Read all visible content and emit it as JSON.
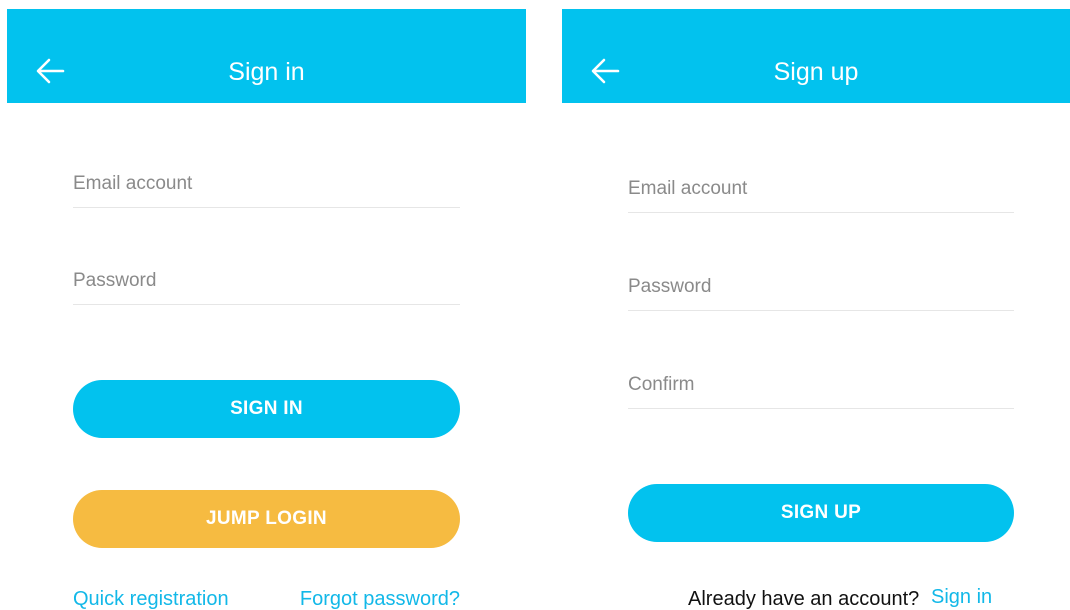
{
  "colors": {
    "accent": "#02c2ee",
    "secondary": "#f6bb41",
    "link": "#12b8e8"
  },
  "signin": {
    "title": "Sign in",
    "back_icon": "arrow-left-icon",
    "email_placeholder": "Email account",
    "password_placeholder": "Password",
    "signin_button": "SIGN IN",
    "jump_button": "JUMP LOGIN",
    "quick_registration": "Quick registration",
    "forgot_password": "Forgot password?"
  },
  "signup": {
    "title": "Sign up",
    "back_icon": "arrow-left-icon",
    "email_placeholder": "Email account",
    "password_placeholder": "Password",
    "confirm_placeholder": "Confirm",
    "signup_button": "SIGN UP",
    "have_account_text": "Already have an account?",
    "signin_link": "Sign in"
  }
}
